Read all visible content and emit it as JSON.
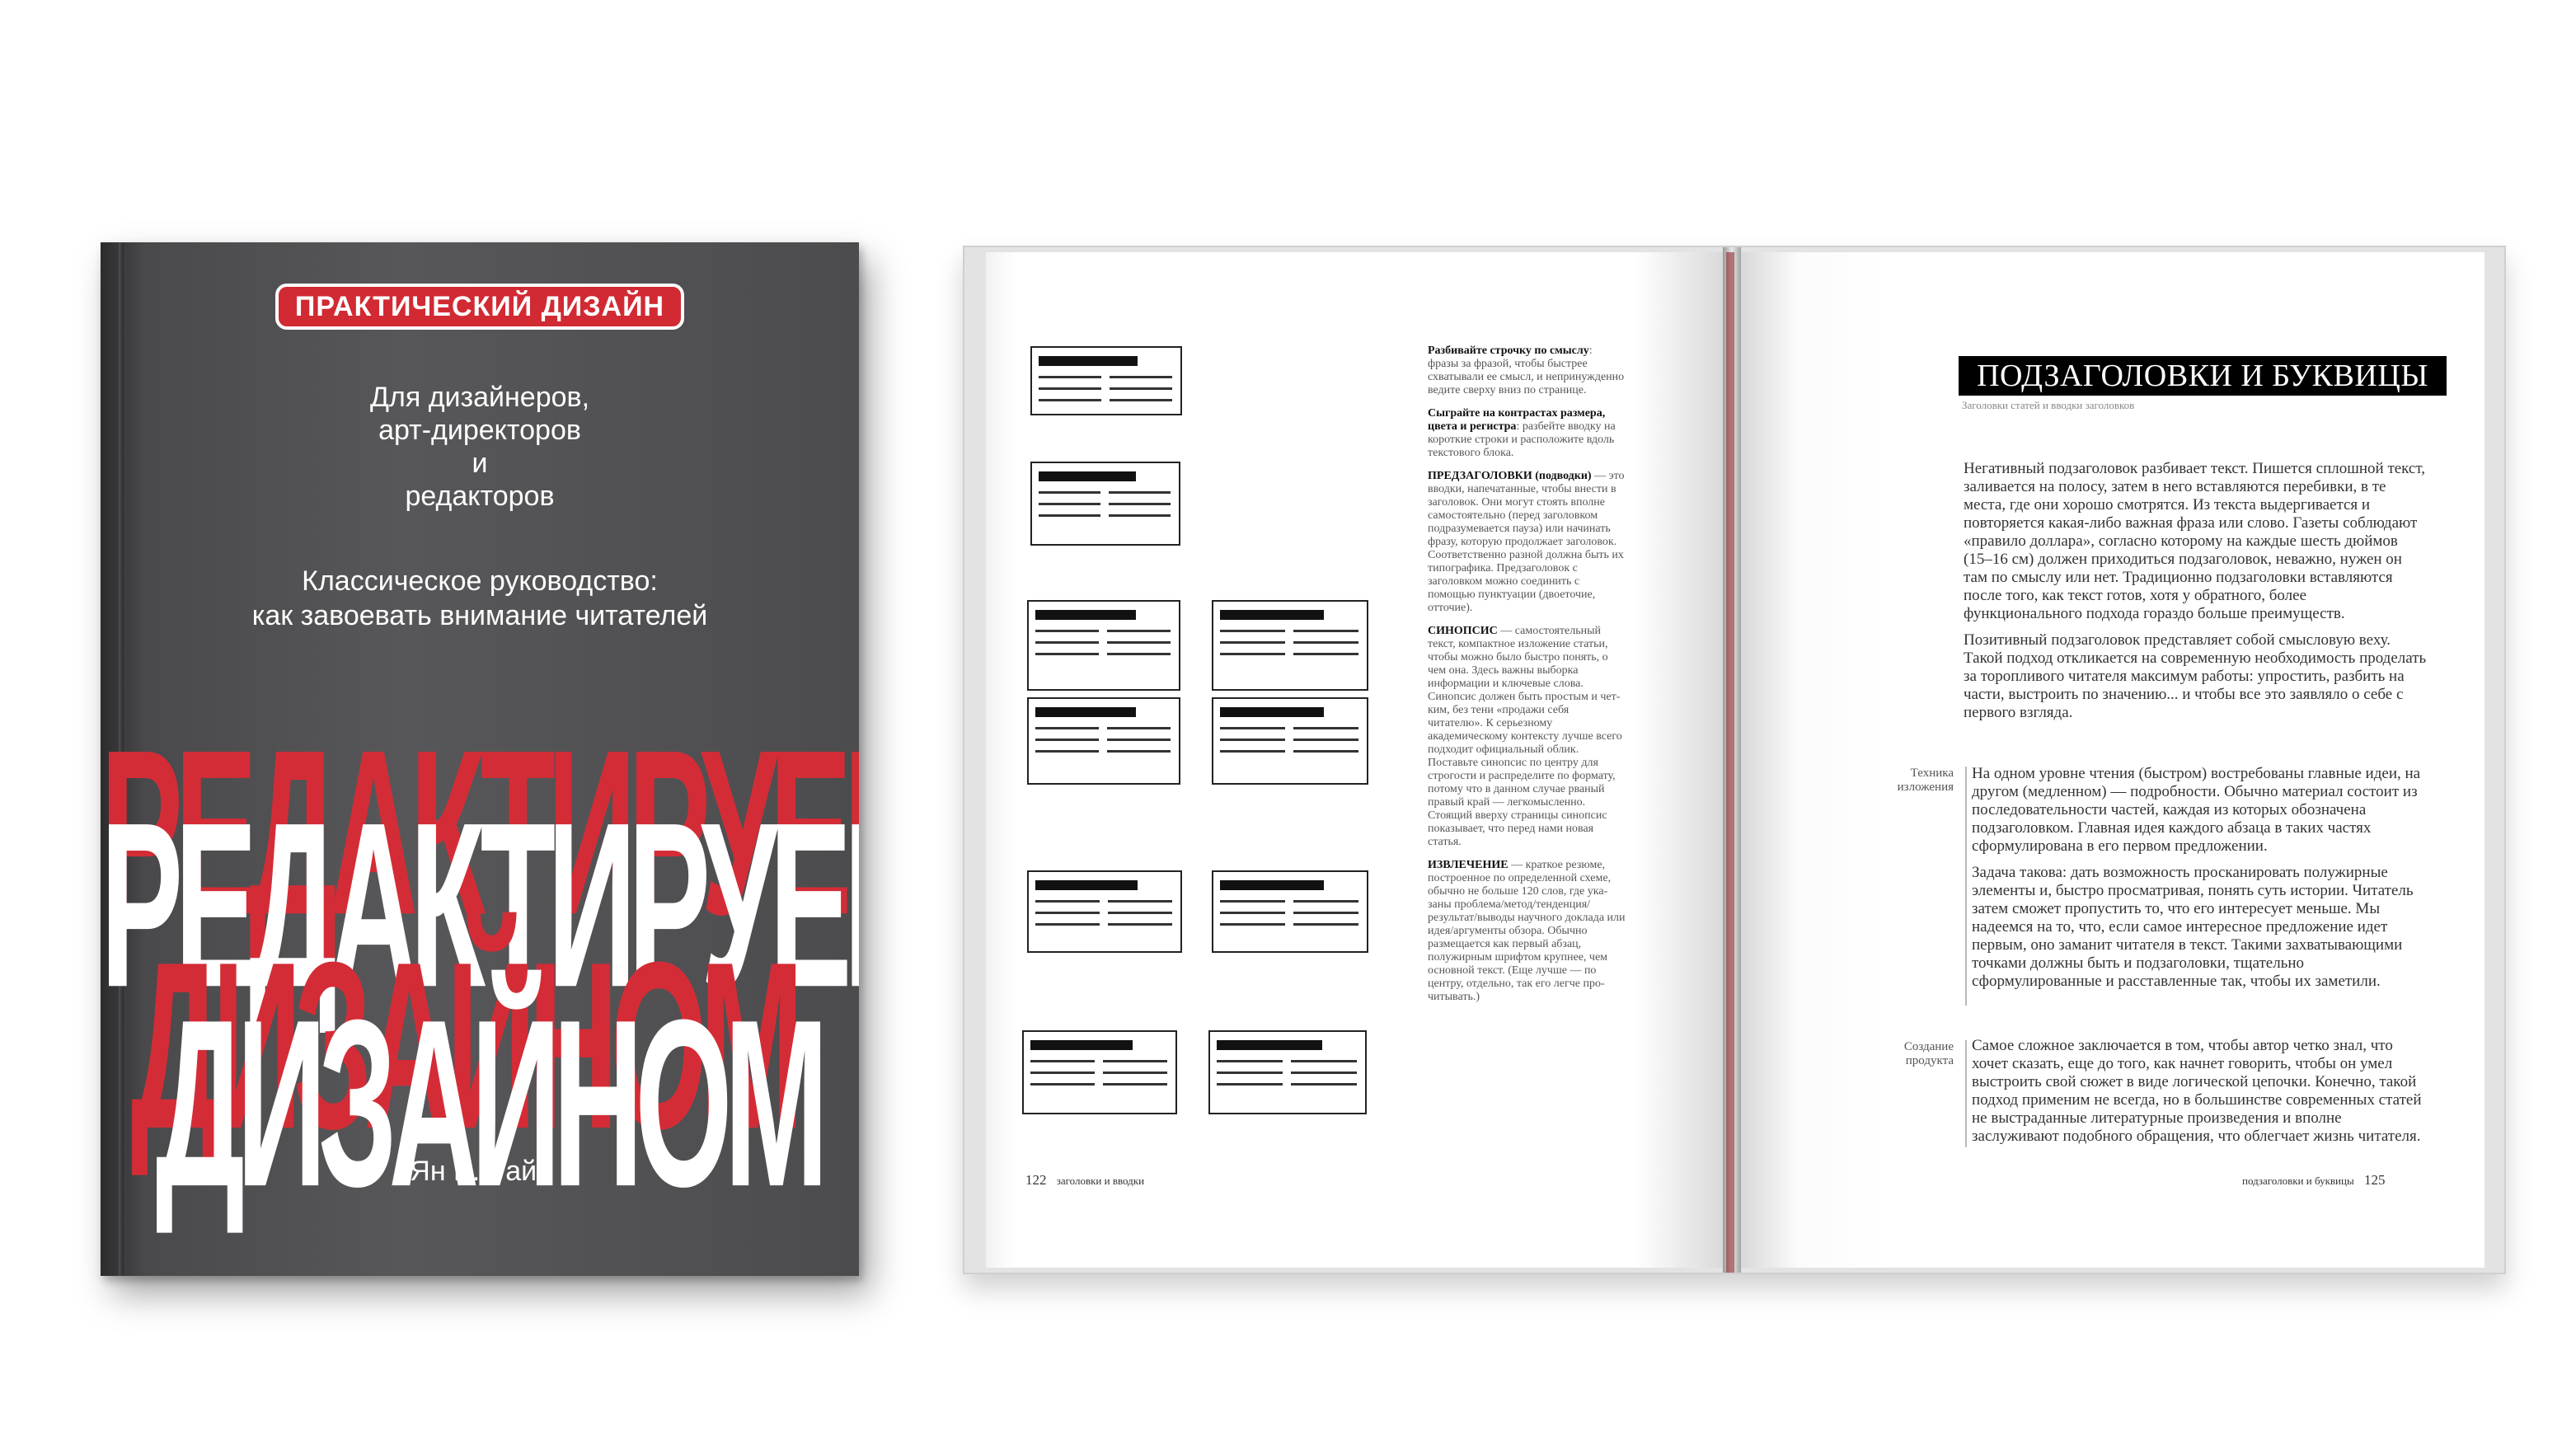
{
  "cover": {
    "series": "ПРАКТИЧЕСКИЙ ДИЗАЙН",
    "audience": [
      "Для дизайнеров,",
      "арт-директоров",
      "и",
      "редакторов"
    ],
    "tagline": [
      "Классическое руководство:",
      "как завоевать внимание читателей"
    ],
    "title_line1": "РЕДАКТИРУЕМ",
    "title_line2": "ДИЗАЙНОМ",
    "author": "Ян В. Уайт",
    "colors": {
      "accent": "#d12a33",
      "cover": "#4f4f51"
    }
  },
  "left_page": {
    "side_notes": [
      {
        "lead": "Разбивайте строчку по смыслу",
        "text": ": фразы за фразой, чтобы быстрее схватывали ее смысл, и неприну­жденно ведите сверху вниз по стра­нице."
      },
      {
        "lead": "Сыграйте на контрастах размера, цвета и регистра",
        "text": ": разбейте вводку на короткие строки и расположите вдоль текстового блока."
      },
      {
        "lead": "ПРЕДЗАГОЛОВКИ (подводки)",
        "text": " — это вводки, напечатанные, чтобы внести в заголовок. Они могут стоять вполне самостоятельно (пе­ред заголовком подразуме­вается пауза) или начинать фразу, которую продолжает заголовок. Соответственно разной должна быть их ти­пографика. Предзаголовок с заголовком можно соединить с помощью пунктуации (двоеточие, отточие)."
      },
      {
        "lead": "СИНОПСИС",
        "text": " — самостоя­тельный текст, компактное изложение статьи, чтобы можно было быстро по­нять, о чем она. Здесь важны выборка информации и ключевые слова. Синопсис должен быть простым и чет­ким, без тени «продажи себя читателю». К серьезному академическому контексту лучше всего подходит офи­циальный облик. Поставьте синопсис по центру для строгости и распределите по формату, потому что в данном случае рваный пра­вый край — легкомысленно. Стоящий вверху страницы синопсис показывает, что перед нами новая статья."
      },
      {
        "lead": "ИЗВЛЕЧЕНИЕ",
        "text": " — краткое резюме, построенное по оп­ределенной схеме, обычно не больше 120 слов, где ука­заны проблема/метод/тен­денция/результат/выводы научного доклада или идея/аргументы обзора. Обычно размещается как первый аб­зац, полужирным шрифтом крупнее, чем основной текст. (Еще лучше — по центру, отдельно, так его легче про­читывать.)"
      }
    ],
    "footer_number": "122",
    "footer_text": "заголовки и вводки"
  },
  "right_page": {
    "section_title": "ПОДЗАГОЛОВКИ И БУКВИЦЫ",
    "section_subtitle": "Заголовки статей и вводки заголовков",
    "intro_paragraphs": [
      "Негативный подзаголовок разбивает текст. Пишется сплошной текст, заливается на полосу, затем в него встав­ляются перебивки, в те места, где они хорошо смотрятся. Из текста выдергивается и повторяется какая-либо важная фраза или слово. Газеты соблюдают «правило доллара», согласно которому на каждые шесть дюймов (15–16 см) должен приходиться подзаголовок, неважно, нужен он там по смыслу или нет. Традиционно подзаголовки встав­ляются после того, как текст готов, хотя у обратного, более функционального подхода гораздо больше преимуществ.",
      "Позитивный подзаголовок представляет собой смысло­вую веху. Такой подход откликается на современную необходимость проделать за торопливого читателя мак­симум работы: упростить, разбить на части, выстроить по значению... и чтобы все это заявляло о себе с первого взгляда."
    ],
    "technique_label": "Техника изложения",
    "technique_paragraphs": [
      "На одном уровне чтения (быстром) востребованы глав­ные идеи, на другом (медленном) — подробности. Обычно материал состоит из последовательности частей, каждая из которых обозначена подзаголовком. Главная идея каж­дого абзаца в таких частях сформулирована в его первом предложении.",
      "Задача такова: дать возможность просканировать полу­жирные элементы и, быстро просматривая, понять суть истории. Читатель затем сможет пропустить то, что его интересует меньше. Мы надеемся на то, что, если са­мое интересное предложение идет первым, оно заманит читателя в текст. Такими захватывающими точками долж­ны быть и подзаголовки, тщательно сформулированные и расставленные так, чтобы их заметили."
    ],
    "product_label": "Создание продукта",
    "product_paragraph": "Самое сложное заключается в том, чтобы автор четко знал, что хочет сказать, еще до того, как начнет говорить, чтобы он умел выстроить свой сюжет в виде логической цепочки. Конечно, такой подход применим не всегда, но в большинстве современных статей не выстраданные лите­ратурные произведения и вполне заслуживают подобного обращения, что облегчает жизнь читателя.",
    "footer_text": "подзаголовки и буквицы",
    "footer_number": "125"
  }
}
